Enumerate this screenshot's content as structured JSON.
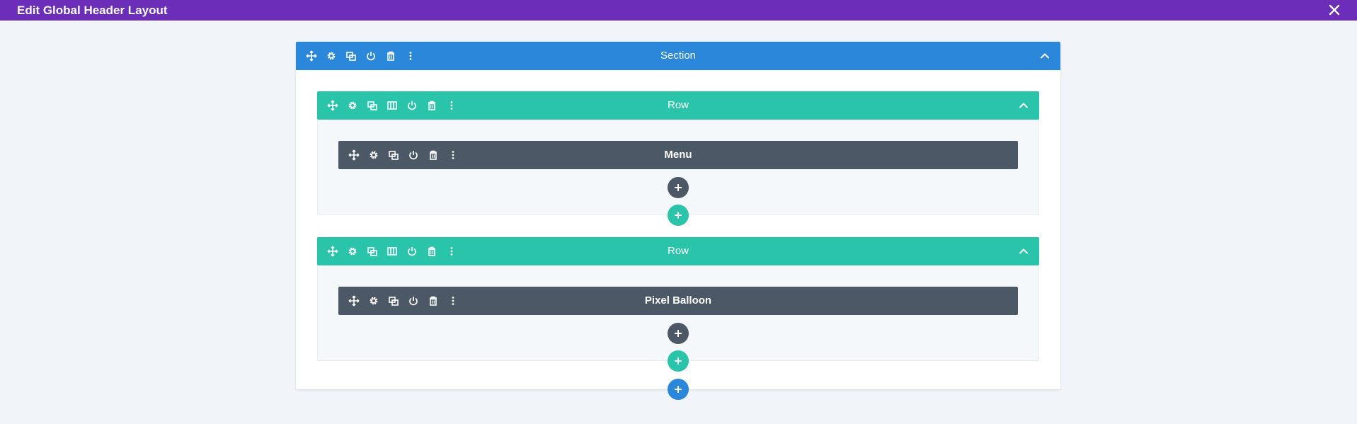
{
  "window": {
    "title": "Edit Global Header Layout",
    "close_icon": "close-icon"
  },
  "colors": {
    "topbar": "#6c2eb9",
    "section": "#2b87da",
    "row": "#29c4a9",
    "module": "#4c5866",
    "background": "#f1f5f9"
  },
  "section": {
    "label": "Section",
    "tools": [
      "move-icon",
      "gear-icon",
      "duplicate-icon",
      "power-icon",
      "trash-icon",
      "more-icon"
    ],
    "rows": [
      {
        "label": "Row",
        "tools": [
          "move-icon",
          "gear-icon",
          "duplicate-icon",
          "columns-icon",
          "power-icon",
          "trash-icon",
          "more-icon"
        ],
        "modules": [
          {
            "label": "Menu",
            "tools": [
              "move-icon",
              "gear-icon",
              "duplicate-icon",
              "power-icon",
              "trash-icon",
              "more-icon"
            ]
          }
        ]
      },
      {
        "label": "Row",
        "tools": [
          "move-icon",
          "gear-icon",
          "duplicate-icon",
          "columns-icon",
          "power-icon",
          "trash-icon",
          "more-icon"
        ],
        "modules": [
          {
            "label": "Pixel Balloon",
            "tools": [
              "move-icon",
              "gear-icon",
              "duplicate-icon",
              "power-icon",
              "trash-icon",
              "more-icon"
            ]
          }
        ]
      }
    ]
  }
}
